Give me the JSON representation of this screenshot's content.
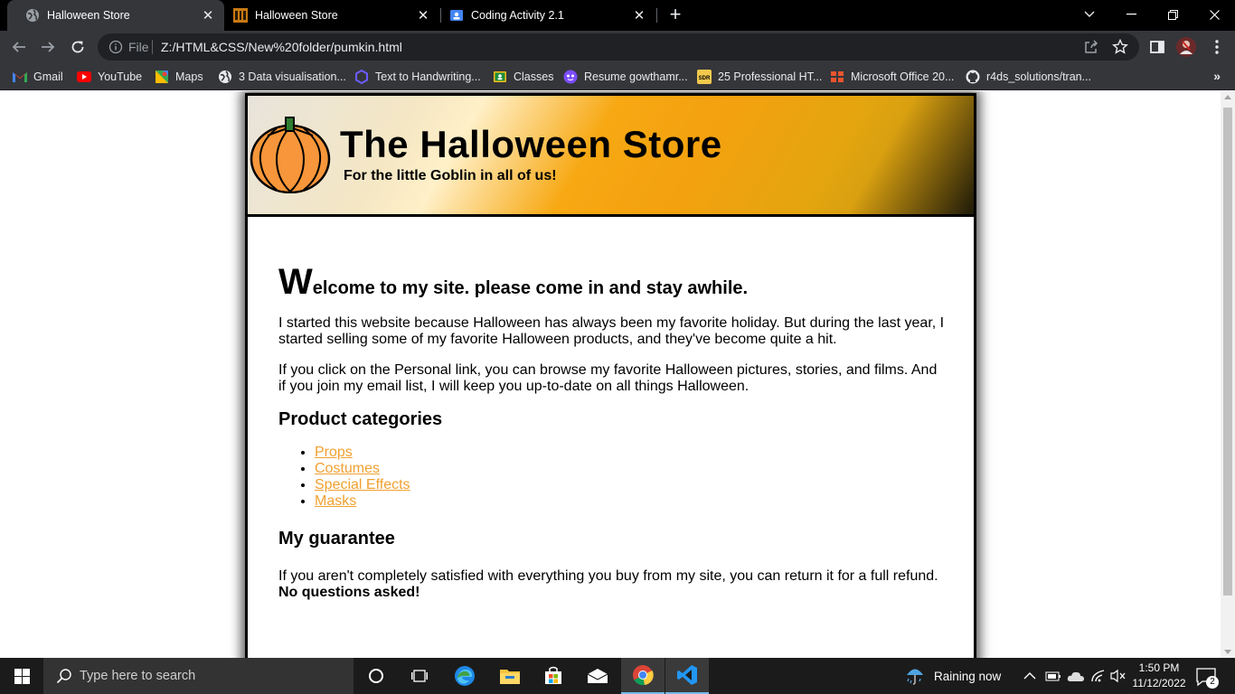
{
  "browser": {
    "tabs": [
      {
        "title": "Halloween Store",
        "active": true,
        "icon": "globe-icon"
      },
      {
        "title": "Halloween Store",
        "active": false,
        "icon": "halloween-favicon-icon"
      },
      {
        "title": "Coding Activity 2.1",
        "active": false,
        "icon": "classroom-icon"
      }
    ],
    "omnibox": {
      "scheme_label": "File",
      "url": "Z:/HTML&CSS/New%20folder/pumkin.html"
    },
    "bookmarks": [
      {
        "label": "Gmail",
        "icon": "gmail-icon"
      },
      {
        "label": "YouTube",
        "icon": "youtube-icon"
      },
      {
        "label": "Maps",
        "icon": "maps-icon"
      },
      {
        "label": "3 Data visualisation...",
        "icon": "globe-icon"
      },
      {
        "label": "Text to Handwriting...",
        "icon": "hexagon-icon"
      },
      {
        "label": "Classes",
        "icon": "classroom-icon"
      },
      {
        "label": "Resume gowthamr...",
        "icon": "resume-icon"
      },
      {
        "label": "25 Professional HT...",
        "icon": "sdr-icon"
      },
      {
        "label": "Microsoft Office 20...",
        "icon": "office-icon"
      },
      {
        "label": "r4ds_solutions/tran...",
        "icon": "github-icon"
      }
    ],
    "bookmarks_more": "»"
  },
  "site": {
    "title": "The Halloween Store",
    "tagline": "For the little Goblin in all of us!",
    "welcome_cap": "W",
    "welcome_rest": "elcome to my site. please come in and stay awhile.",
    "para1": "I started this website because Halloween has always been my favorite holiday. But during the last year, I started selling some of my favorite Halloween products, and they've become quite a hit.",
    "para2": "If you click on the Personal link, you can browse my favorite Halloween pictures, stories, and films. And if you join my email list, I will keep you up-to-date on all things Halloween.",
    "categories_heading": "Product categories",
    "categories": [
      "Props",
      "Costumes",
      "Special Effects",
      "Masks"
    ],
    "guarantee_heading": "My guarantee",
    "guarantee_text": "If you aren't completely satisfied with everything you buy from my site, you can return it for a full refund.",
    "guarantee_bold": "No questions asked!",
    "link_color": "#f0a030"
  },
  "taskbar": {
    "search_placeholder": "Type here to search",
    "weather": "Raining now",
    "time": "1:50 PM",
    "date": "11/12/2022",
    "notification_count": "2"
  }
}
